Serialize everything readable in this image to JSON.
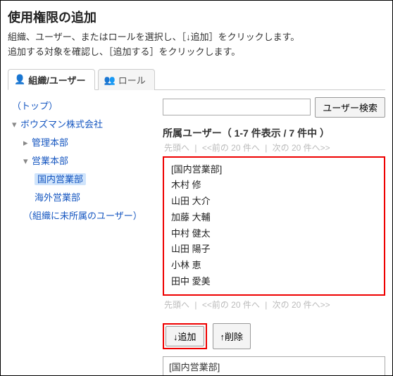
{
  "header": {
    "title": "使用権限の追加",
    "desc_line1": "組織、ユーザー、またはロールを選択し、［↓追加］をクリックします。",
    "desc_line2": "追加する対象を確認し、［追加する］をクリックします。"
  },
  "tabs": {
    "org_user": "組織/ユーザー",
    "role": "ロール"
  },
  "tree": {
    "top": "（トップ）",
    "company": "ボウズマン株式会社",
    "dept1": "管理本部",
    "dept2": "営業本部",
    "dept2a": "国内営業部",
    "dept2b": "海外営業部",
    "no_org": "（組織に未所属のユーザー）"
  },
  "search": {
    "placeholder": "",
    "button": "ユーザー検索"
  },
  "section": {
    "title": "所属ユーザー（ 1-7 件表示 / 7 件中 ）"
  },
  "pager": {
    "first": "先頭へ",
    "prev": "<<前の 20 件へ",
    "next": "次の 20 件へ>>",
    "sep": " | "
  },
  "users": [
    "[国内営業部]",
    "木村 修",
    "山田 大介",
    "加藤 大輔",
    "中村 健太",
    "山田 陽子",
    "小林 恵",
    "田中 愛美"
  ],
  "actions": {
    "add": "↓追加",
    "remove": "↑削除"
  },
  "selected": {
    "value": "[国内営業部]"
  }
}
